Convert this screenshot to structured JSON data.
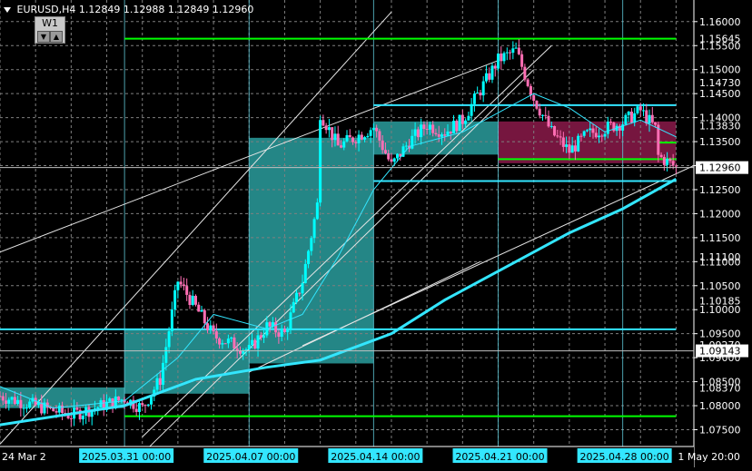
{
  "header": {
    "symbol": "EURUSD,H4",
    "quotes": "1.12849 1.12988 1.12849 1.12960",
    "timeframe_button": "W1",
    "down_arrow_icon": "triangle-down-icon",
    "up_arrow_icon": "triangle-up-icon"
  },
  "colors": {
    "background": "#000000",
    "grid": "#7f7f7f",
    "axis_text": "#ffffff",
    "bull_candle": "#00ffff",
    "bear_candle": "#ff6eb4",
    "cyan_line": "#33e6ff",
    "green_line": "#00ff00",
    "teal_zone": "#2a9d9d",
    "maroon_zone": "#8b1a4a",
    "label_bg": "#ffffff",
    "time_label_bg": "#33e6ff"
  },
  "chart_data": {
    "type": "candlestick",
    "symbol": "EURUSD",
    "timeframe": "H4",
    "ylim": [
      1.0715,
      1.1645
    ],
    "xlim": [
      "2025-03-24",
      "2025-05-02"
    ],
    "grid": true,
    "price_ticks": [
      1.16,
      1.155,
      1.15,
      1.145,
      1.14,
      1.135,
      1.13,
      1.125,
      1.12,
      1.115,
      1.11,
      1.105,
      1.1,
      1.095,
      1.09,
      1.085,
      1.08,
      1.075
    ],
    "price_ticks_text": [
      "1.16000",
      "1.15500",
      "1.15000",
      "1.14500",
      "1.14000",
      "1.13500",
      "1.13000",
      "1.12500",
      "1.12000",
      "1.11500",
      "1.11000",
      "1.10500",
      "1.10000",
      "1.09500",
      "1.09000",
      "1.08500",
      "1.08000",
      "1.07500"
    ],
    "level_labels": [
      {
        "price": 1.15645,
        "text": "1.15645"
      },
      {
        "price": 1.1473,
        "text": "1.14730"
      },
      {
        "price": 1.1383,
        "text": "1.13830"
      },
      {
        "price": 1.111,
        "text": "1.11100"
      },
      {
        "price": 1.10185,
        "text": "1.10185"
      },
      {
        "price": 1.0927,
        "text": "1.09270"
      },
      {
        "price": 1.0837,
        "text": "1.08370"
      }
    ],
    "current_price": {
      "price": 1.1296,
      "text": "1.12960"
    },
    "current_price_2": {
      "price": 1.09143,
      "text": "1.09143"
    },
    "time_labels": [
      {
        "date": "2025-03-24",
        "text": "24 Mar 2"
      },
      {
        "date": "2025-04-01",
        "text": "00"
      },
      {
        "date": "2025-04-08",
        "text": "00"
      },
      {
        "date": "2025-04-15",
        "text": "7"
      },
      {
        "date": "2025-04-22",
        "text": "2"
      },
      {
        "date": "2025-04-29",
        "text": "00"
      },
      {
        "date": "2025-05-01",
        "text": "1 May 20:00"
      }
    ],
    "highlighted_times": [
      {
        "date": "2025-03-31",
        "text": "2025.03.31 00:00"
      },
      {
        "date": "2025-04-07",
        "text": "2025.04.07 00:00"
      },
      {
        "date": "2025-04-14",
        "text": "2025.04.14 00:00"
      },
      {
        "date": "2025-04-21",
        "text": "2025.04.21 00:00"
      },
      {
        "date": "2025-04-28",
        "text": "2025.04.28 00:00"
      }
    ],
    "horizontal_levels": [
      {
        "color": "green",
        "price": 1.15645,
        "from": "2025-03-31",
        "to": "2025-05-01"
      },
      {
        "color": "green",
        "price": 1.0778,
        "from": "2025-03-31",
        "to": "2025-05-01"
      },
      {
        "color": "green",
        "price": 1.13135,
        "from": "2025-04-21",
        "to": "2025-05-01"
      },
      {
        "color": "green",
        "price": 1.1348,
        "from": "2025-04-30",
        "to": "2025-05-01"
      },
      {
        "color": "cyan",
        "price": 1.1426,
        "from": "2025-04-14",
        "to": "2025-05-01"
      },
      {
        "color": "cyan",
        "price": 1.1268,
        "from": "2025-04-14",
        "to": "2025-05-01"
      },
      {
        "color": "cyan",
        "price": 1.0959,
        "from": "2025-03-24",
        "to": "2025-05-01"
      }
    ],
    "zones": [
      {
        "color": "teal",
        "from": "2025-03-24",
        "to": "2025-03-31",
        "low": 1.0795,
        "high": 1.0838
      },
      {
        "color": "teal",
        "from": "2025-03-31",
        "to": "2025-04-07",
        "low": 1.0825,
        "high": 1.0959
      },
      {
        "color": "teal",
        "from": "2025-04-07",
        "to": "2025-04-14",
        "low": 1.0888,
        "high": 1.1358
      },
      {
        "color": "teal",
        "from": "2025-04-14",
        "to": "2025-04-21",
        "low": 1.1323,
        "high": 1.1392
      },
      {
        "color": "maroon",
        "from": "2025-04-21",
        "to": "2025-05-01",
        "low": 1.1305,
        "high": 1.1392
      }
    ],
    "trendlines": [
      {
        "color": "white",
        "from": [
          "2025-03-24",
          1.112
        ],
        "to": [
          "2025-04-21",
          1.1519
        ]
      },
      {
        "color": "white",
        "from": [
          "2025-03-24",
          1.072
        ],
        "to": [
          "2025-04-15",
          1.162
        ]
      },
      {
        "color": "white",
        "from": [
          "2025-04-01",
          1.07
        ],
        "to": [
          "2025-04-23",
          1.15
        ]
      },
      {
        "color": "white",
        "from": [
          "2025-04-01",
          1.0735
        ],
        "to": [
          "2025-04-24",
          1.155
        ]
      },
      {
        "color": "white",
        "from": [
          "2025-04-10",
          1.0925
        ],
        "to": [
          "2025-05-02",
          1.13
        ]
      },
      {
        "color": "white",
        "from": [
          "2025-04-07",
          1.087
        ],
        "to": [
          "2025-04-20",
          1.11
        ]
      }
    ],
    "moving_averages": [
      {
        "name": "slow",
        "color": "cyan",
        "width": 3,
        "points": [
          [
            "2025-03-24",
            1.076
          ],
          [
            "2025-03-31",
            1.08
          ],
          [
            "2025-04-04",
            1.0855
          ],
          [
            "2025-04-08",
            1.088
          ],
          [
            "2025-04-11",
            1.0895
          ],
          [
            "2025-04-15",
            1.095
          ],
          [
            "2025-04-18",
            1.102
          ],
          [
            "2025-04-22",
            1.11
          ],
          [
            "2025-04-25",
            1.116
          ],
          [
            "2025-04-28",
            1.121
          ],
          [
            "2025-05-01",
            1.1272
          ]
        ]
      },
      {
        "name": "fast",
        "color": "cyan",
        "width": 1,
        "points": [
          [
            "2025-03-24",
            1.084
          ],
          [
            "2025-03-27",
            1.0795
          ],
          [
            "2025-03-31",
            1.081
          ],
          [
            "2025-04-03",
            1.09
          ],
          [
            "2025-04-05",
            1.099
          ],
          [
            "2025-04-08",
            1.096
          ],
          [
            "2025-04-10",
            1.099
          ],
          [
            "2025-04-12",
            1.111
          ],
          [
            "2025-04-14",
            1.125
          ],
          [
            "2025-04-16",
            1.134
          ],
          [
            "2025-04-19",
            1.137
          ],
          [
            "2025-04-22",
            1.143
          ],
          [
            "2025-04-23",
            1.145
          ],
          [
            "2025-04-25",
            1.142
          ],
          [
            "2025-04-27",
            1.137
          ],
          [
            "2025-04-29",
            1.1395
          ],
          [
            "2025-05-01",
            1.136
          ]
        ]
      }
    ],
    "candle_path": [
      [
        "2025-03-24",
        1.082
      ],
      [
        "2025-03-26",
        1.08
      ],
      [
        "2025-03-28",
        1.078
      ],
      [
        "2025-03-31",
        1.0815
      ],
      [
        "2025-04-01",
        1.0795
      ],
      [
        "2025-04-02",
        1.0855
      ],
      [
        "2025-04-03",
        1.106
      ],
      [
        "2025-04-04",
        1.1005
      ],
      [
        "2025-04-05",
        1.0945
      ],
      [
        "2025-04-07",
        1.0915
      ],
      [
        "2025-04-08",
        1.0965
      ],
      [
        "2025-04-09",
        1.095
      ],
      [
        "2025-04-10",
        1.106
      ],
      [
        "2025-04-11",
        1.125
      ],
      [
        "2025-04-11",
        1.141
      ],
      [
        "2025-04-12",
        1.134
      ],
      [
        "2025-04-14",
        1.138
      ],
      [
        "2025-04-15",
        1.13
      ],
      [
        "2025-04-16",
        1.135
      ],
      [
        "2025-04-17",
        1.1385
      ],
      [
        "2025-04-18",
        1.137
      ],
      [
        "2025-04-19",
        1.1395
      ],
      [
        "2025-04-21",
        1.152
      ],
      [
        "2025-04-22",
        1.154
      ],
      [
        "2025-04-23",
        1.144
      ],
      [
        "2025-04-24",
        1.137
      ],
      [
        "2025-04-25",
        1.133
      ],
      [
        "2025-04-26",
        1.1365
      ],
      [
        "2025-04-28",
        1.139
      ],
      [
        "2025-04-29",
        1.1415
      ],
      [
        "2025-04-30",
        1.137
      ],
      [
        "2025-04-30",
        1.132
      ],
      [
        "2025-05-01",
        1.1296
      ]
    ]
  }
}
